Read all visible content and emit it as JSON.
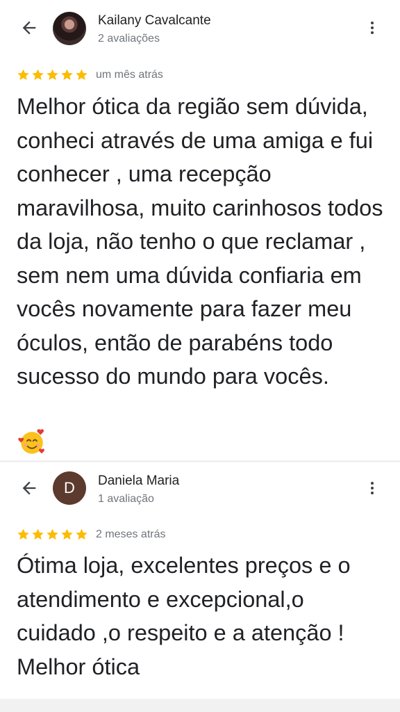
{
  "reviews": [
    {
      "author": "Kailany Cavalcante",
      "review_count": "2 avaliações",
      "avatar": "photo",
      "rating": 5,
      "date": "um mês atrás",
      "text": "Melhor ótica da região sem dúvida, conheci através de uma amiga e fui conhecer , uma recepção maravilhosa, muito carinhosos todos da loja, não tenho o que reclamar , sem nem uma dúvida confiaria em vocês novamente para fazer meu óculos, então de parabéns todo sucesso do mundo para vocês.",
      "emoji": "smiling-face-with-hearts-emoji"
    },
    {
      "author": "Daniela Maria",
      "review_count": "1 avaliação",
      "avatar_letter": "D",
      "rating": 5,
      "date": "2 meses atrás",
      "text": "Ótima loja, excelentes preços e o atendimento e excepcional,o cuidado ,o respeito e a atenção ! Melhor ótica"
    }
  ],
  "colors": {
    "star": "#fbbc04",
    "avatar_bg": "#5d3a2e",
    "text_primary": "#202124",
    "text_secondary": "#70757a",
    "icon": "#3c4043",
    "separator": "#f1f1f1"
  },
  "icons": [
    "back-arrow-icon",
    "more-vert-icon",
    "star-icon"
  ]
}
